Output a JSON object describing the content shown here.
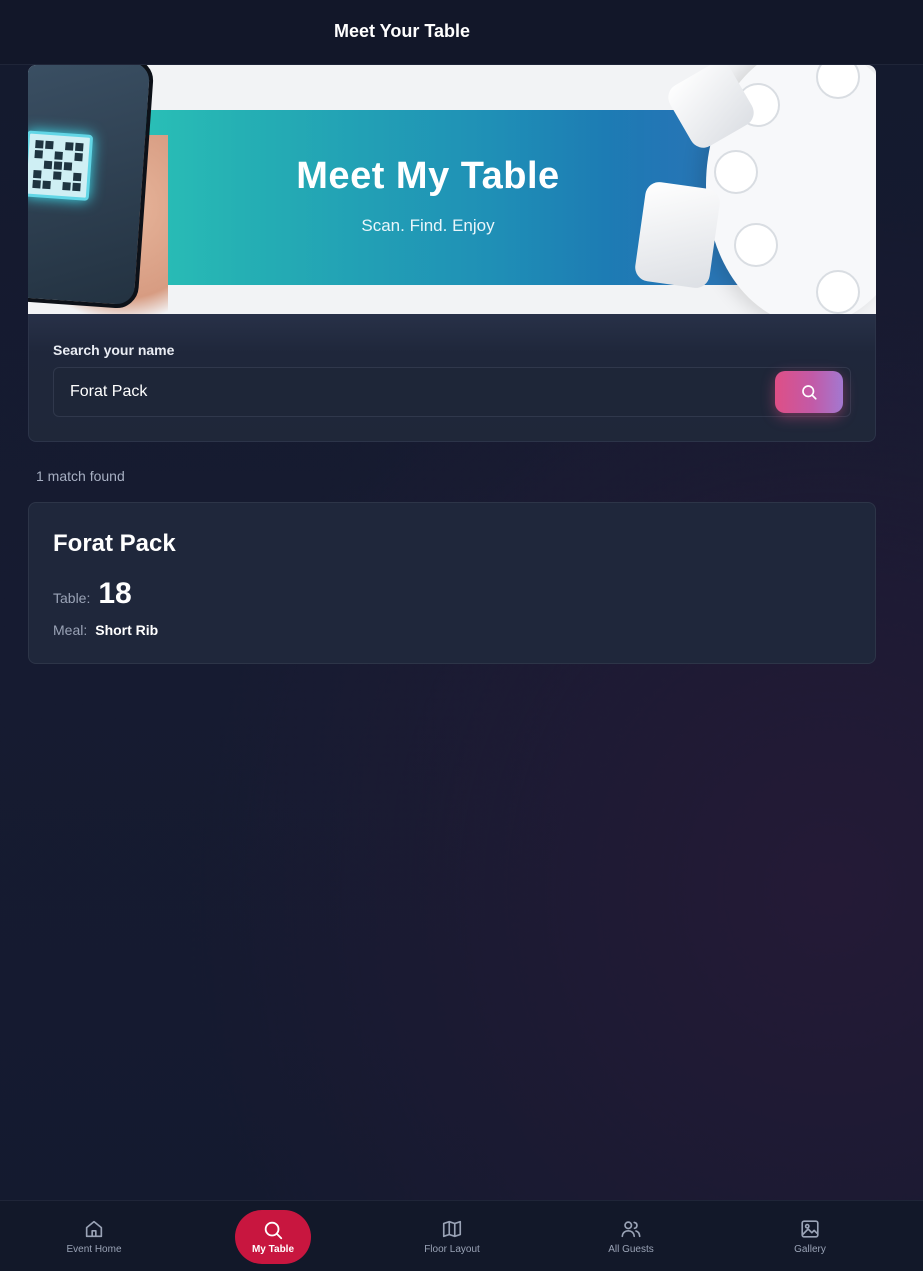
{
  "header": {
    "title": "Meet Your Table"
  },
  "banner": {
    "title": "Meet My Table",
    "subtitle": "Scan. Find. Enjoy"
  },
  "search": {
    "label": "Search your name",
    "value": "Forat Pack",
    "button_icon": "search-icon"
  },
  "results": {
    "summary": "1 match found",
    "items": [
      {
        "name": "Forat Pack",
        "table_label": "Table:",
        "table": "18",
        "meal_label": "Meal:",
        "meal": "Short Rib"
      }
    ]
  },
  "nav": {
    "items": [
      {
        "label": "Event Home",
        "icon": "home-icon"
      },
      {
        "label": "My Table",
        "icon": "search-icon",
        "active": true
      },
      {
        "label": "Floor Layout",
        "icon": "map-icon"
      },
      {
        "label": "All Guests",
        "icon": "users-icon"
      },
      {
        "label": "Gallery",
        "icon": "image-icon"
      }
    ]
  },
  "colors": {
    "accent": "#c8163f",
    "search_button_start": "#de4f86",
    "search_button_end": "#a378d0",
    "background": "#141a2e"
  }
}
